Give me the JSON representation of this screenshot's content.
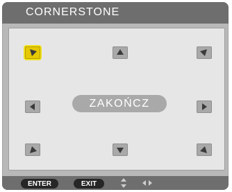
{
  "menu": {
    "title": "CORNERSTONE",
    "center_button_label": "ZAKOŃCZ",
    "selected_corner": "top-left"
  },
  "footer": {
    "enter_label": "ENTER",
    "exit_label": "EXIT",
    "up_down_icon": "up-down-arrows-icon",
    "left_right_icon": "left-right-arrows-icon"
  },
  "corner_buttons": [
    {
      "name": "top-left",
      "arrow": "down-right"
    },
    {
      "name": "top",
      "arrow": "up"
    },
    {
      "name": "top-right",
      "arrow": "down-left"
    },
    {
      "name": "left",
      "arrow": "left"
    },
    {
      "name": "right",
      "arrow": "right"
    },
    {
      "name": "bottom-left",
      "arrow": "up-right"
    },
    {
      "name": "bottom",
      "arrow": "down"
    },
    {
      "name": "bottom-right",
      "arrow": "up-left"
    }
  ],
  "colors": {
    "panel": "#b8b8b8",
    "title_bar": "#6e6e6e",
    "inner_panel": "#e6e6e6",
    "button": "#a9a9a9",
    "selected": "#e6c800",
    "pill": "#262626"
  }
}
